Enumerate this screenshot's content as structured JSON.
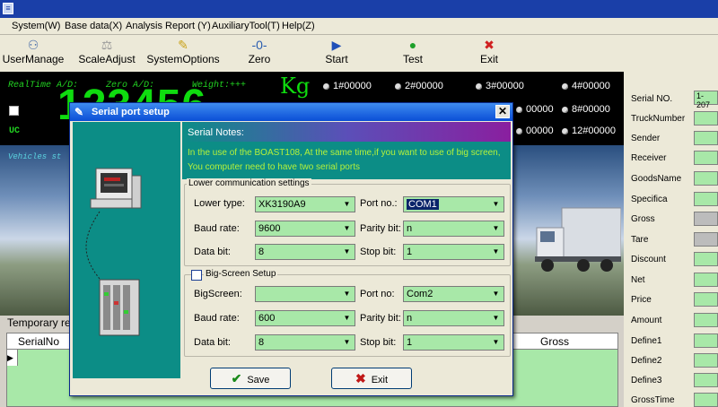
{
  "menu": [
    "System(W)",
    "Base data(X)",
    "Analysis Report (Y)",
    "AuxiliaryTool(T)",
    "Help(Z)"
  ],
  "toolbar": [
    {
      "label": "UserManage",
      "icon": "users-icon"
    },
    {
      "label": "ScaleAdjust",
      "icon": "scale-icon"
    },
    {
      "label": "SystemOptions",
      "icon": "options-icon"
    },
    {
      "label": "Zero",
      "icon": "zero-icon"
    },
    {
      "label": "Start",
      "icon": "play-icon"
    },
    {
      "label": "Test",
      "icon": "test-icon"
    },
    {
      "label": "Exit",
      "icon": "exit-icon"
    }
  ],
  "display": {
    "realtime_ad": "RealTime A/D:",
    "zero_ad": "Zero A/D:",
    "weight": "Weight:+++",
    "big_weight": "123456",
    "unit": "Kg",
    "uc": "UC",
    "vehicles_status": "Vehicles st",
    "scales": [
      "1#00000",
      "2#00000",
      "3#00000",
      "4#00000",
      "00000",
      "8#00000",
      "00000",
      "12#00000"
    ]
  },
  "temp": {
    "label": "Temporary re",
    "columns": [
      "SerialNo",
      "Gross"
    ]
  },
  "right_panel": {
    "serial_value": "1-207",
    "fields": [
      "Serial NO.",
      "TruckNumber",
      "Sender",
      "Receiver",
      "GoodsName",
      "Specifica",
      "Gross",
      "Tare",
      "Discount",
      "Net",
      "Price",
      "Amount",
      "Define1",
      "Define2",
      "Define3",
      "GrossTime"
    ]
  },
  "dialog": {
    "title": "Serial port setup",
    "notes_title": "Serial Notes:",
    "notes_line1": "In the use of the BOAST108, At the same time,if you want to use of big screen,",
    "notes_line2": "You computer need to have two serial ports",
    "lower": {
      "group_label": "Lower communication settings",
      "lower_type_label": "Lower type:",
      "lower_type": "XK3190A9",
      "port_label": "Port no.:",
      "port": "COM1",
      "baud_label": "Baud rate:",
      "baud": "9600",
      "parity_label": "Parity bit:",
      "parity": "n",
      "data_label": "Data bit:",
      "data": "8",
      "stop_label": "Stop bit:",
      "stop": "1"
    },
    "big": {
      "group_label": "Big-Screen Setup",
      "screen_label": "BigScreen:",
      "screen": "",
      "port_label": "Port no:",
      "port": "Com2",
      "baud_label": "Baud rate:",
      "baud": "600",
      "parity_label": "Parity bit:",
      "parity": "n",
      "data_label": "Data bit:",
      "data": "8",
      "stop_label": "Stop bit:",
      "stop": "1"
    },
    "save_label": "Save",
    "exit_label": "Exit"
  }
}
